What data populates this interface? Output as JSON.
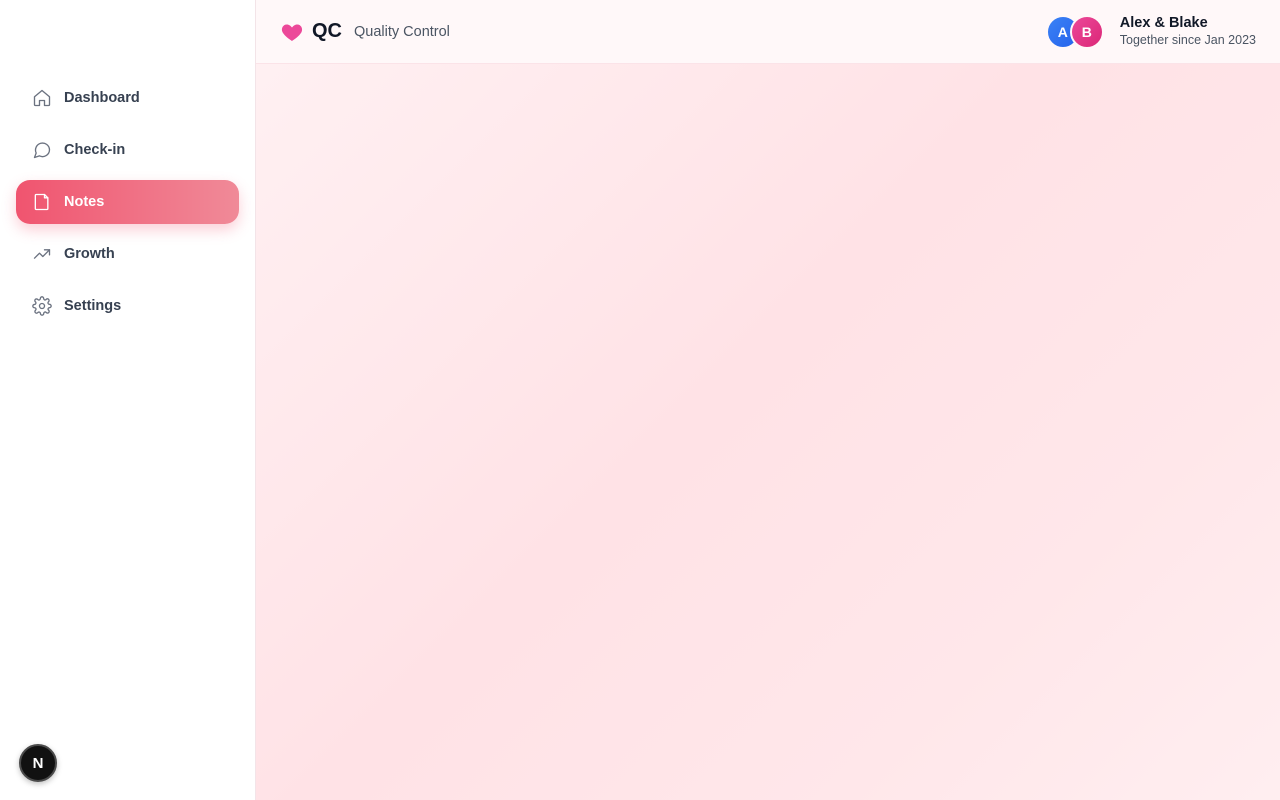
{
  "header": {
    "logo_text": "QC",
    "subtitle": "Quality Control",
    "couple": {
      "avatar_a": "A",
      "avatar_b": "B",
      "names": "Alex & Blake",
      "since": "Together since Jan 2023"
    }
  },
  "sidebar": {
    "items": [
      {
        "label": "Dashboard",
        "icon": "home-icon",
        "active": false
      },
      {
        "label": "Check-in",
        "icon": "message-circle-icon",
        "active": false
      },
      {
        "label": "Notes",
        "icon": "note-icon",
        "active": true
      },
      {
        "label": "Growth",
        "icon": "trending-up-icon",
        "active": false
      },
      {
        "label": "Settings",
        "icon": "gear-icon",
        "active": false
      }
    ]
  },
  "dev_badge": {
    "letter": "N"
  },
  "colors": {
    "accent": "#f0546f",
    "heart": "#ec4899",
    "avatar_a": "#3b82f6",
    "avatar_b": "#ec4899",
    "main_bg": "#ffe4e8"
  }
}
